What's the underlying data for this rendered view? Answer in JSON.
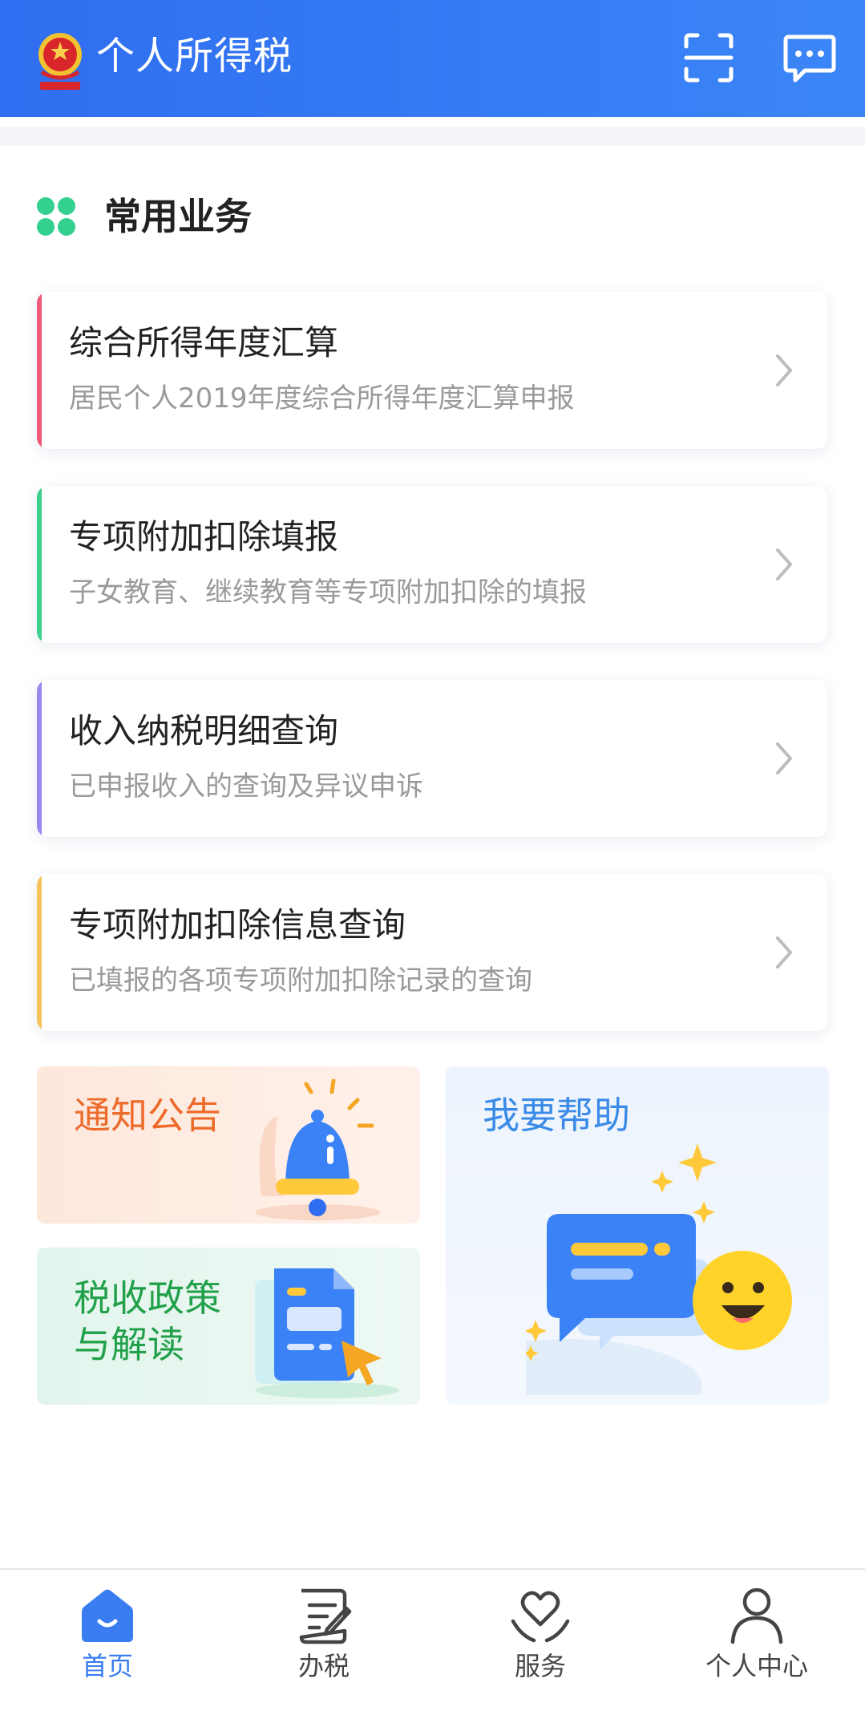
{
  "header": {
    "title": "个人所得税",
    "emblem_icon": "national-emblem-icon",
    "scan_icon": "scan-icon",
    "message_icon": "message-icon",
    "background": "#2f6ef0"
  },
  "section": {
    "title": "常用业务",
    "icon": "grid-icon",
    "icon_color": "#34d08f"
  },
  "services": [
    {
      "title": "综合所得年度汇算",
      "subtitle": "居民个人2019年度综合所得年度汇算申报",
      "accent": "#ee5a78"
    },
    {
      "title": "专项附加扣除填报",
      "subtitle": "子女教育、继续教育等专项附加扣除的填报",
      "accent": "#3ccf8e"
    },
    {
      "title": "收入纳税明细查询",
      "subtitle": "已申报收入的查询及异议申诉",
      "accent": "#9b87f0"
    },
    {
      "title": "专项附加扣除信息查询",
      "subtitle": "已填报的各项专项附加扣除记录的查询",
      "accent": "#f6c35a"
    }
  ],
  "tiles": {
    "notice": {
      "label": "通知公告",
      "icon": "bell-icon",
      "color": "#ee6a2a"
    },
    "policy": {
      "label": "税收政策\n与解读",
      "icon": "document-icon",
      "color": "#21a04a"
    },
    "help": {
      "label": "我要帮助",
      "icon": "chat-smile-icon",
      "color": "#3a8be8"
    }
  },
  "nav": [
    {
      "label": "首页",
      "icon": "home-icon",
      "active": true
    },
    {
      "label": "办税",
      "icon": "tax-form-icon",
      "active": false
    },
    {
      "label": "服务",
      "icon": "heart-hands-icon",
      "active": false
    },
    {
      "label": "个人中心",
      "icon": "person-icon",
      "active": false
    }
  ],
  "colors": {
    "active": "#3a7df0",
    "inactive": "#444444"
  }
}
